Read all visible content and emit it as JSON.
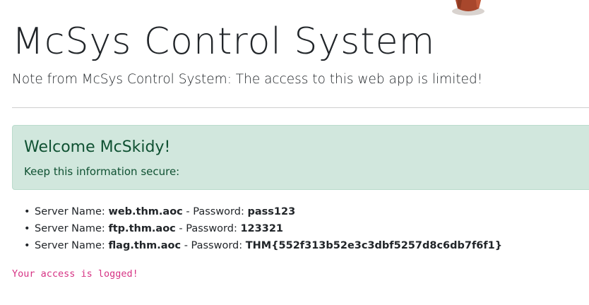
{
  "header": {
    "title": "McSys Control System",
    "note": "Note from McSys Control System: The access to this web app is limited!"
  },
  "alert": {
    "heading": "Welcome McSkidy!",
    "text": "Keep this information secure:"
  },
  "servers": {
    "name_label": "Server Name:",
    "separator": "- Password:",
    "bullet": "•",
    "items": [
      {
        "name": "web.thm.aoc",
        "password": "pass123"
      },
      {
        "name": "ftp.thm.aoc",
        "password": "123321"
      },
      {
        "name": "flag.thm.aoc",
        "password": "THM{552f313b52e3c3dbf5257d8c6db7f6f1}"
      }
    ]
  },
  "footer": {
    "logged_message": "Your access is logged!"
  },
  "colors": {
    "alert_bg": "#d1e7dd",
    "alert_text": "#0f5132",
    "code_pink": "#d63384"
  },
  "icons": {
    "mascot": "elf-mascot-icon"
  }
}
